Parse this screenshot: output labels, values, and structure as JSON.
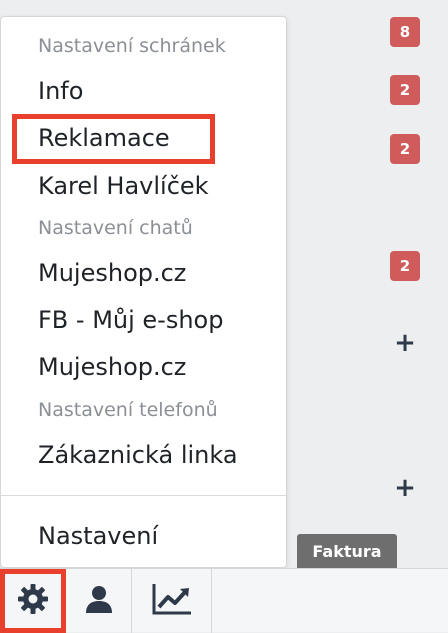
{
  "menu": {
    "headers": {
      "mailboxes": "Nastavení schránek",
      "chats": "Nastavení chatů",
      "phones": "Nastavení telefonů"
    },
    "items": {
      "info": "Info",
      "reklamace": "Reklamace",
      "karel": "Karel Havlíček",
      "mujeshop1": "Mujeshop.cz",
      "fb": "FB - Můj e-shop",
      "mujeshop2": "Mujeshop.cz",
      "zakaznicka": "Zákaznická linka",
      "nastaveni": "Nastavení"
    }
  },
  "badges": [
    "8",
    "2",
    "2",
    "2"
  ],
  "plus_icons": [
    "+",
    "+"
  ],
  "tab_label": "Faktura",
  "toolbar": {
    "icons": [
      "gear-icon",
      "user-icon",
      "chart-line-icon"
    ]
  },
  "colors": {
    "badge": "#cf5b5b",
    "highlight": "#e8402c",
    "tab": "#6e6e6e"
  }
}
